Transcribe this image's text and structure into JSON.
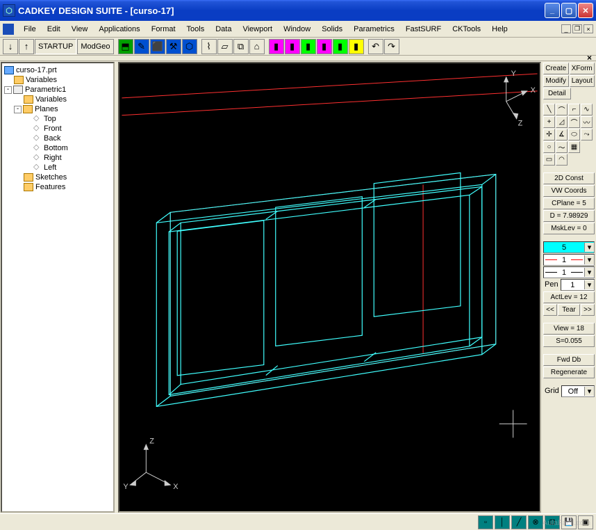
{
  "title": "CADKEY DESIGN SUITE - [curso-17]",
  "menu": [
    "File",
    "Edit",
    "View",
    "Applications",
    "Format",
    "Tools",
    "Data",
    "Viewport",
    "Window",
    "Solids",
    "Parametrics",
    "FastSURF",
    "CKTools",
    "Help"
  ],
  "toolbar_text": {
    "startup": "STARTUP",
    "modgeo": "ModGeo"
  },
  "tree": {
    "root": "curso-17.prt",
    "variables": "Variables",
    "parametric": "Parametric1",
    "variables2": "Variables",
    "planes": "Planes",
    "plane_items": [
      "Top",
      "Front",
      "Back",
      "Bottom",
      "Right",
      "Left"
    ],
    "sketches": "Sketches",
    "features": "Features"
  },
  "axes": {
    "x": "X",
    "y": "Y",
    "z": "Z"
  },
  "rpanel": {
    "create": "Create",
    "xform": "XForm",
    "modify": "Modify",
    "layout": "Layout",
    "detail": "Detail",
    "const2d": "2D Const",
    "vwcoords": "VW Coords",
    "cplane": "CPlane = 5",
    "d": "D = 7.98929",
    "msklev": "MskLev = 0",
    "color_val": "5",
    "line1": "1",
    "line2": "1",
    "pen_label": "Pen",
    "pen_val": "1",
    "actlev": "ActLev = 12",
    "prev": "<<",
    "tear": "Tear",
    "next": ">>",
    "view": "View = 18",
    "scale": "S=0.055",
    "fwddb": "Fwd Db",
    "regen": "Regenerate",
    "grid_label": "Grid",
    "grid_val": "Off"
  },
  "watermark": "AulaFacil.com"
}
